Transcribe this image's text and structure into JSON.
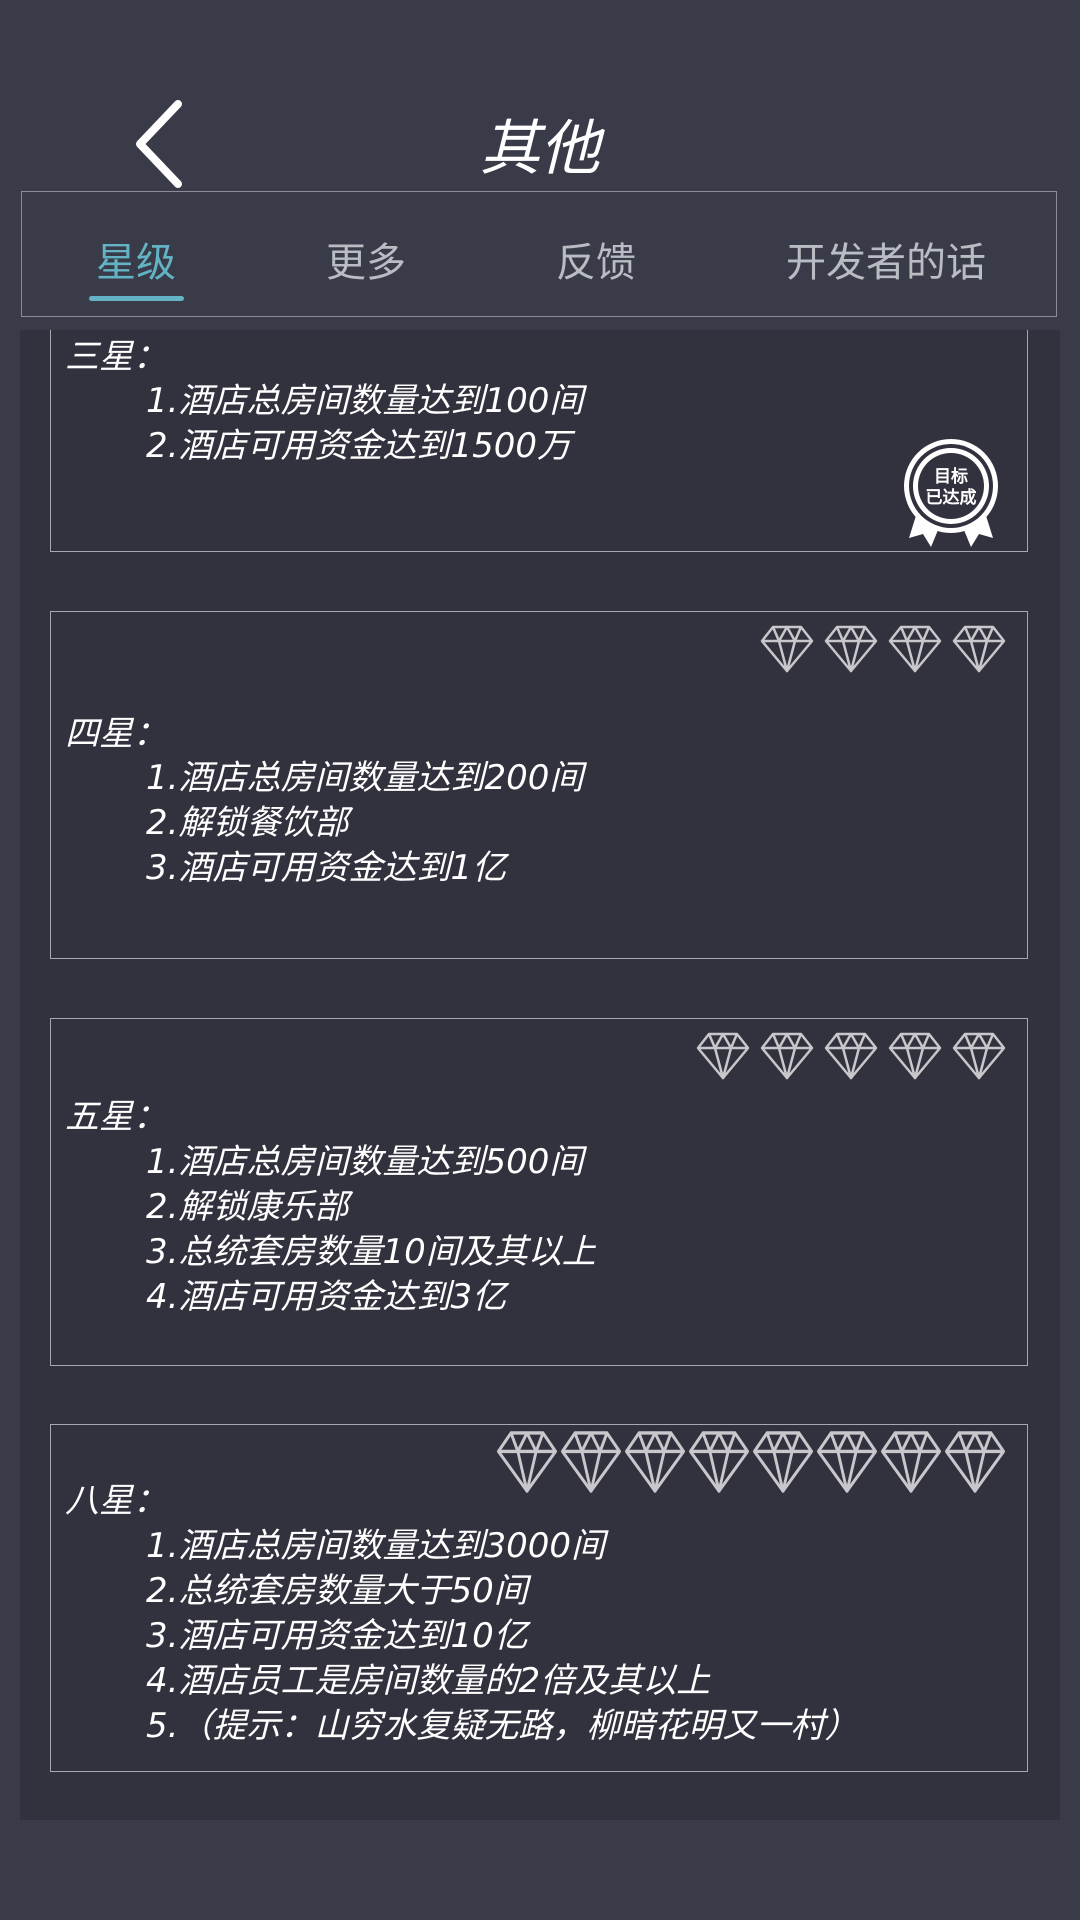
{
  "header": {
    "title": "其他"
  },
  "tabs": [
    {
      "label": "星级",
      "active": true
    },
    {
      "label": "更多",
      "active": false
    },
    {
      "label": "反馈",
      "active": false
    },
    {
      "label": "开发者的话",
      "active": false
    }
  ],
  "colors": {
    "accent": "#63b3c4",
    "background": "#393c48",
    "panel": "#32323e",
    "diamond": "#c8c8cc"
  },
  "cards": [
    {
      "title": "三星：",
      "requirements": [
        "1.酒店总房间数量达到100间",
        "2.酒店可用资金达到1500万"
      ],
      "badge": {
        "line1": "目标",
        "line2": "已达成"
      }
    },
    {
      "title": "四星：",
      "diamonds": 4,
      "requirements": [
        "1.酒店总房间数量达到200间",
        "2.解锁餐饮部",
        "3.酒店可用资金达到1亿"
      ]
    },
    {
      "title": "五星：",
      "diamonds": 5,
      "requirements": [
        "1.酒店总房间数量达到500间",
        "2.解锁康乐部",
        "3.总统套房数量10间及其以上",
        "4.酒店可用资金达到3亿"
      ]
    },
    {
      "title": "八星：",
      "diamonds": 8,
      "requirements": [
        "1.酒店总房间数量达到3000间",
        "2.总统套房数量大于50间",
        "3.酒店可用资金达到10亿",
        "4.酒店员工是房间数量的2倍及其以上",
        "5.（提示：山穷水复疑无路，柳暗花明又一村）"
      ]
    }
  ]
}
